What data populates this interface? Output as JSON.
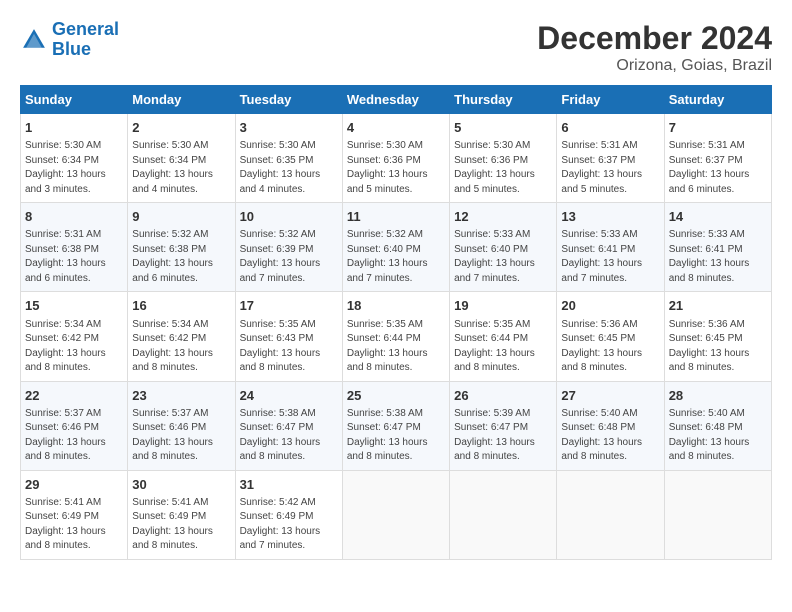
{
  "logo": {
    "line1": "General",
    "line2": "Blue"
  },
  "title": "December 2024",
  "subtitle": "Orizona, Goias, Brazil",
  "weekdays": [
    "Sunday",
    "Monday",
    "Tuesday",
    "Wednesday",
    "Thursday",
    "Friday",
    "Saturday"
  ],
  "weeks": [
    [
      {
        "day": "1",
        "info": "Sunrise: 5:30 AM\nSunset: 6:34 PM\nDaylight: 13 hours\nand 3 minutes."
      },
      {
        "day": "2",
        "info": "Sunrise: 5:30 AM\nSunset: 6:34 PM\nDaylight: 13 hours\nand 4 minutes."
      },
      {
        "day": "3",
        "info": "Sunrise: 5:30 AM\nSunset: 6:35 PM\nDaylight: 13 hours\nand 4 minutes."
      },
      {
        "day": "4",
        "info": "Sunrise: 5:30 AM\nSunset: 6:36 PM\nDaylight: 13 hours\nand 5 minutes."
      },
      {
        "day": "5",
        "info": "Sunrise: 5:30 AM\nSunset: 6:36 PM\nDaylight: 13 hours\nand 5 minutes."
      },
      {
        "day": "6",
        "info": "Sunrise: 5:31 AM\nSunset: 6:37 PM\nDaylight: 13 hours\nand 5 minutes."
      },
      {
        "day": "7",
        "info": "Sunrise: 5:31 AM\nSunset: 6:37 PM\nDaylight: 13 hours\nand 6 minutes."
      }
    ],
    [
      {
        "day": "8",
        "info": "Sunrise: 5:31 AM\nSunset: 6:38 PM\nDaylight: 13 hours\nand 6 minutes."
      },
      {
        "day": "9",
        "info": "Sunrise: 5:32 AM\nSunset: 6:38 PM\nDaylight: 13 hours\nand 6 minutes."
      },
      {
        "day": "10",
        "info": "Sunrise: 5:32 AM\nSunset: 6:39 PM\nDaylight: 13 hours\nand 7 minutes."
      },
      {
        "day": "11",
        "info": "Sunrise: 5:32 AM\nSunset: 6:40 PM\nDaylight: 13 hours\nand 7 minutes."
      },
      {
        "day": "12",
        "info": "Sunrise: 5:33 AM\nSunset: 6:40 PM\nDaylight: 13 hours\nand 7 minutes."
      },
      {
        "day": "13",
        "info": "Sunrise: 5:33 AM\nSunset: 6:41 PM\nDaylight: 13 hours\nand 7 minutes."
      },
      {
        "day": "14",
        "info": "Sunrise: 5:33 AM\nSunset: 6:41 PM\nDaylight: 13 hours\nand 8 minutes."
      }
    ],
    [
      {
        "day": "15",
        "info": "Sunrise: 5:34 AM\nSunset: 6:42 PM\nDaylight: 13 hours\nand 8 minutes."
      },
      {
        "day": "16",
        "info": "Sunrise: 5:34 AM\nSunset: 6:42 PM\nDaylight: 13 hours\nand 8 minutes."
      },
      {
        "day": "17",
        "info": "Sunrise: 5:35 AM\nSunset: 6:43 PM\nDaylight: 13 hours\nand 8 minutes."
      },
      {
        "day": "18",
        "info": "Sunrise: 5:35 AM\nSunset: 6:44 PM\nDaylight: 13 hours\nand 8 minutes."
      },
      {
        "day": "19",
        "info": "Sunrise: 5:35 AM\nSunset: 6:44 PM\nDaylight: 13 hours\nand 8 minutes."
      },
      {
        "day": "20",
        "info": "Sunrise: 5:36 AM\nSunset: 6:45 PM\nDaylight: 13 hours\nand 8 minutes."
      },
      {
        "day": "21",
        "info": "Sunrise: 5:36 AM\nSunset: 6:45 PM\nDaylight: 13 hours\nand 8 minutes."
      }
    ],
    [
      {
        "day": "22",
        "info": "Sunrise: 5:37 AM\nSunset: 6:46 PM\nDaylight: 13 hours\nand 8 minutes."
      },
      {
        "day": "23",
        "info": "Sunrise: 5:37 AM\nSunset: 6:46 PM\nDaylight: 13 hours\nand 8 minutes."
      },
      {
        "day": "24",
        "info": "Sunrise: 5:38 AM\nSunset: 6:47 PM\nDaylight: 13 hours\nand 8 minutes."
      },
      {
        "day": "25",
        "info": "Sunrise: 5:38 AM\nSunset: 6:47 PM\nDaylight: 13 hours\nand 8 minutes."
      },
      {
        "day": "26",
        "info": "Sunrise: 5:39 AM\nSunset: 6:47 PM\nDaylight: 13 hours\nand 8 minutes."
      },
      {
        "day": "27",
        "info": "Sunrise: 5:40 AM\nSunset: 6:48 PM\nDaylight: 13 hours\nand 8 minutes."
      },
      {
        "day": "28",
        "info": "Sunrise: 5:40 AM\nSunset: 6:48 PM\nDaylight: 13 hours\nand 8 minutes."
      }
    ],
    [
      {
        "day": "29",
        "info": "Sunrise: 5:41 AM\nSunset: 6:49 PM\nDaylight: 13 hours\nand 8 minutes."
      },
      {
        "day": "30",
        "info": "Sunrise: 5:41 AM\nSunset: 6:49 PM\nDaylight: 13 hours\nand 8 minutes."
      },
      {
        "day": "31",
        "info": "Sunrise: 5:42 AM\nSunset: 6:49 PM\nDaylight: 13 hours\nand 7 minutes."
      },
      null,
      null,
      null,
      null
    ]
  ]
}
